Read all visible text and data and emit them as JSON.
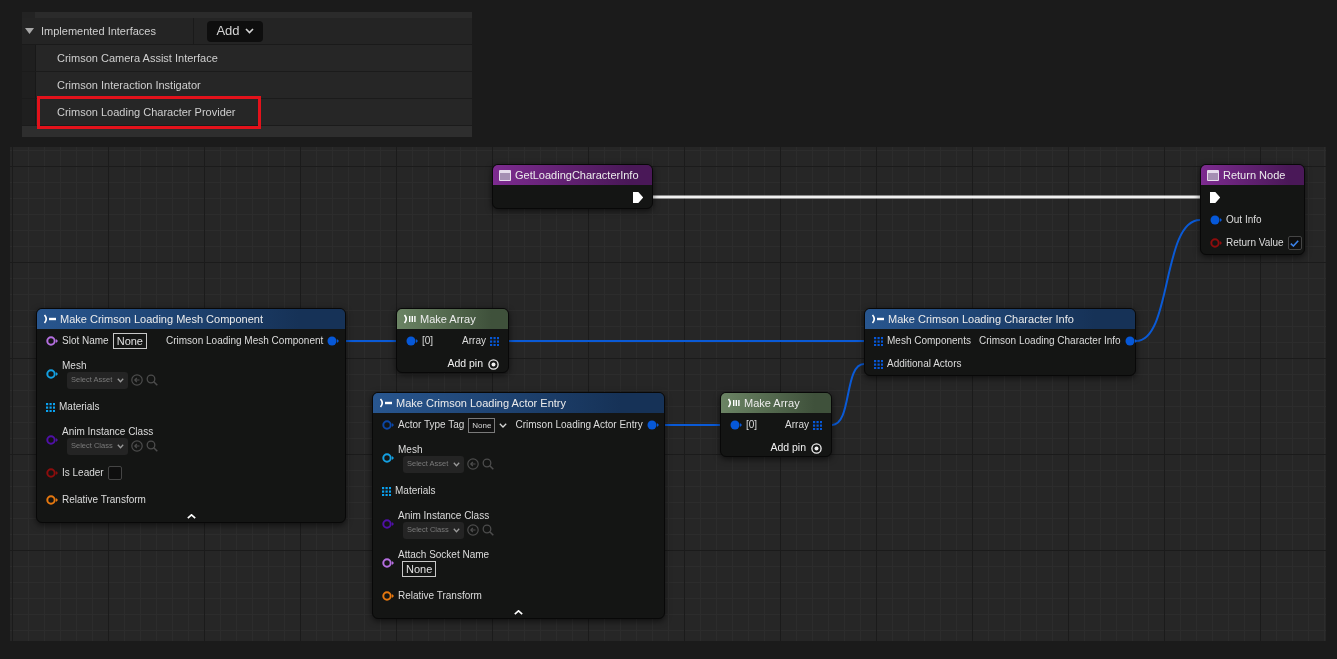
{
  "details_panel": {
    "section_title": "Implemented Interfaces",
    "expanded": true,
    "add_button": "Add",
    "interfaces": [
      {
        "name": "Crimson Camera Assist Interface",
        "highlighted": false
      },
      {
        "name": "Crimson Interaction Instigator",
        "highlighted": false
      },
      {
        "name": "Crimson Loading Character Provider",
        "highlighted": true
      }
    ]
  },
  "graph": {
    "nodes": [
      {
        "kind": "function-entry",
        "title": "GetLoadingCharacterInfo",
        "outputs": [
          {
            "kind": "exec",
            "connected": true
          }
        ]
      },
      {
        "kind": "function-result",
        "title": "Return Node",
        "inputs": [
          {
            "kind": "exec",
            "connected": true
          },
          {
            "kind": "value",
            "label": "Out Info",
            "color": "#0658d8",
            "connected": true
          },
          {
            "kind": "value",
            "label": "Return Value",
            "color": "#8e0d0d",
            "connected": false,
            "editor": {
              "kind": "checkbox",
              "checked": true
            }
          }
        ]
      },
      {
        "kind": "make-struct",
        "title": "Make Crimson Loading Mesh Component",
        "collapse_toggle": true,
        "inputs": [
          {
            "kind": "value",
            "label": "Slot Name",
            "color": "#b56fe0",
            "connected": false,
            "editor": {
              "kind": "text",
              "value": "None"
            }
          },
          {
            "kind": "value",
            "label": "Mesh",
            "color": "#14a0e2",
            "connected": false,
            "editor": {
              "kind": "asset-picker",
              "placeholder": "Select Asset"
            }
          },
          {
            "kind": "array",
            "label": "Materials",
            "color": "#0aa2f0"
          },
          {
            "kind": "value",
            "label": "Anim Instance Class",
            "color": "#5010a8",
            "connected": false,
            "editor": {
              "kind": "class-picker",
              "placeholder": "Select Class"
            }
          },
          {
            "kind": "value",
            "label": "Is Leader",
            "color": "#8e0d0d",
            "connected": false,
            "editor": {
              "kind": "checkbox",
              "checked": false
            }
          },
          {
            "kind": "value",
            "label": "Relative Transform",
            "color": "#e7780f",
            "connected": false
          }
        ],
        "outputs": [
          {
            "kind": "value",
            "label": "Crimson Loading Mesh Component",
            "color": "#0658d8",
            "connected": true
          }
        ]
      },
      {
        "kind": "make-array",
        "title": "Make Array",
        "inputs": [
          {
            "kind": "value",
            "label": "[0]",
            "color": "#0658d8",
            "connected": true
          }
        ],
        "outputs": [
          {
            "kind": "array",
            "label": "Array",
            "color": "#0658d8"
          }
        ],
        "add_pin": "Add pin"
      },
      {
        "kind": "make-struct",
        "title": "Make Crimson Loading Actor Entry",
        "collapse_toggle": true,
        "inputs": [
          {
            "kind": "value",
            "label": "Actor Type Tag",
            "color": "#0b47a8",
            "connected": false,
            "editor": {
              "kind": "tag-dropdown",
              "value": "None"
            }
          },
          {
            "kind": "value",
            "label": "Mesh",
            "color": "#14a0e2",
            "connected": false,
            "editor": {
              "kind": "asset-picker",
              "placeholder": "Select Asset"
            }
          },
          {
            "kind": "array",
            "label": "Materials",
            "color": "#0aa2f0"
          },
          {
            "kind": "value",
            "label": "Anim Instance Class",
            "color": "#5010a8",
            "connected": false,
            "editor": {
              "kind": "class-picker",
              "placeholder": "Select Class"
            }
          },
          {
            "kind": "value",
            "label": "Attach Socket Name",
            "color": "#b56fe0",
            "connected": false,
            "editor": {
              "kind": "text",
              "value": "None"
            }
          },
          {
            "kind": "value",
            "label": "Relative Transform",
            "color": "#e7780f",
            "connected": false
          }
        ],
        "outputs": [
          {
            "kind": "value",
            "label": "Crimson Loading Actor Entry",
            "color": "#0658d8",
            "connected": true
          }
        ]
      },
      {
        "kind": "make-array",
        "title": "Make Array",
        "inputs": [
          {
            "kind": "value",
            "label": "[0]",
            "color": "#0658d8",
            "connected": true
          }
        ],
        "outputs": [
          {
            "kind": "array",
            "label": "Array",
            "color": "#0658d8"
          }
        ],
        "add_pin": "Add pin"
      },
      {
        "kind": "make-struct",
        "title": "Make Crimson Loading Character Info",
        "collapse_toggle": false,
        "inputs": [
          {
            "kind": "array",
            "label": "Mesh Components",
            "color": "#0658d8"
          },
          {
            "kind": "array",
            "label": "Additional Actors",
            "color": "#0658d8"
          }
        ],
        "outputs": [
          {
            "kind": "value",
            "label": "Crimson Loading Character Info",
            "color": "#0658d8",
            "connected": true
          }
        ]
      }
    ],
    "wires": [
      {
        "kind": "exec"
      },
      {
        "kind": "data"
      },
      {
        "kind": "data"
      },
      {
        "kind": "data"
      },
      {
        "kind": "data"
      },
      {
        "kind": "data"
      }
    ]
  }
}
